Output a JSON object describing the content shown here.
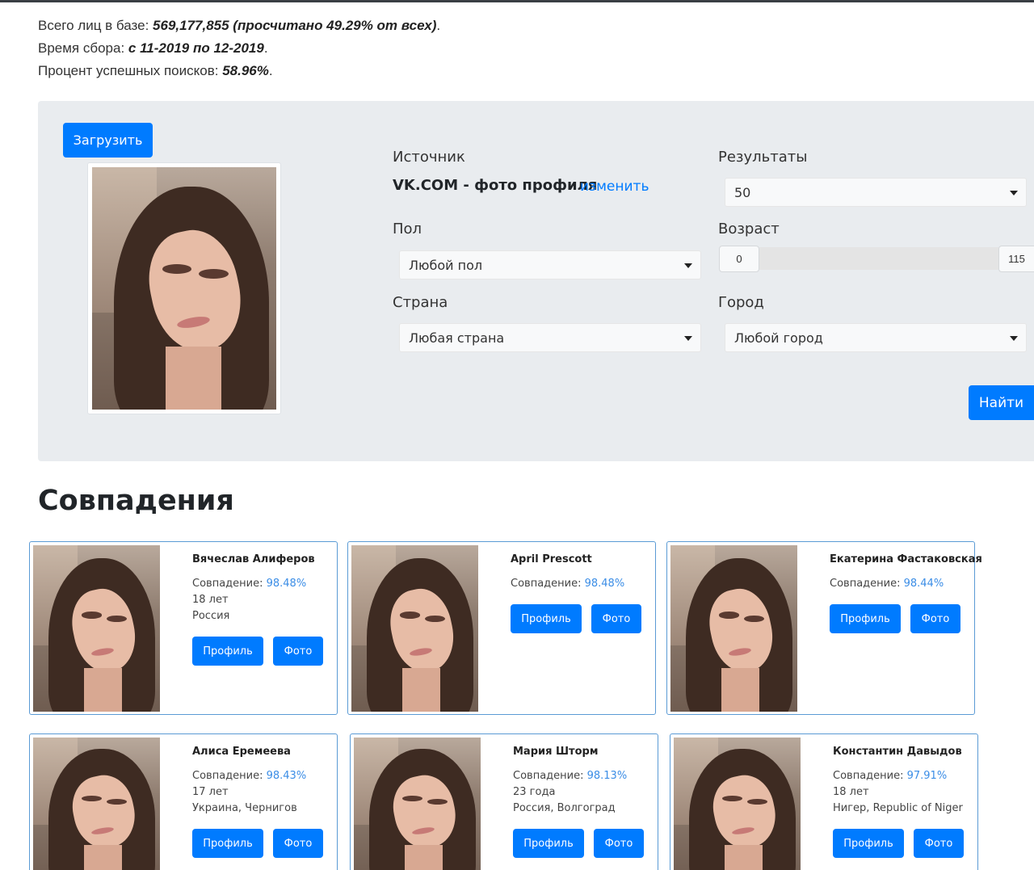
{
  "stats": {
    "total_prefix": "Всего лиц в базе: ",
    "total_value": "569,177,855 (просчитано 49.29% от всех)",
    "period_prefix": "Время сбора: ",
    "period_value": "с 11-2019 по 12-2019",
    "success_prefix": "Процент успешных поисков: ",
    "success_value": "58.96%",
    "dot": "."
  },
  "search": {
    "upload_label": "Загрузить",
    "source_label": "Источник",
    "source_value": "VK.COM - фото профиля",
    "source_change": "изменить",
    "results_label": "Результаты",
    "results_value": "50",
    "gender_label": "Пол",
    "gender_value": "Любой пол",
    "age_label": "Возраст",
    "age_min": "0",
    "age_max": "115",
    "country_label": "Страна",
    "country_value": "Любая страна",
    "city_label": "Город",
    "city_value": "Любой город",
    "find_label": "Найти"
  },
  "results": {
    "heading": "Совпадения",
    "match_label": "Совпадение: ",
    "profile_label": "Профиль",
    "photo_label": "Фото",
    "cards": [
      {
        "name": "Вячеслав Алиферов",
        "match": "98.48%",
        "age": "18 лет",
        "location": "Россия"
      },
      {
        "name": "April Prescott",
        "match": "98.48%",
        "age": "",
        "location": ""
      },
      {
        "name": "Екатерина Фастаковская",
        "match": "98.44%",
        "age": "",
        "location": ""
      },
      {
        "name": "Алиса Еремеева",
        "match": "98.43%",
        "age": "17 лет",
        "location": "Украина, Чернигов"
      },
      {
        "name": "Мария Шторм",
        "match": "98.13%",
        "age": "23 года",
        "location": "Россия, Волгоград"
      },
      {
        "name": "Константин Давыдов",
        "match": "97.91%",
        "age": "18 лет",
        "location": "Нигер, Republic of Niger"
      }
    ]
  }
}
